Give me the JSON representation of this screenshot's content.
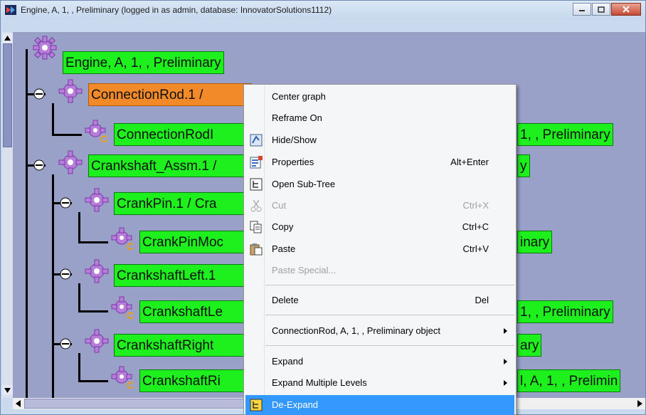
{
  "window": {
    "title": "Engine, A, 1, , Preliminary (logged in as admin, database: InnovatorSolutions1112)"
  },
  "tree": {
    "nodes": [
      {
        "label": "Engine, A, 1, , Preliminary"
      },
      {
        "label": "ConnectionRod.1 /"
      },
      {
        "label": "ConnectionRodI"
      },
      {
        "label": "1, , Preliminary"
      },
      {
        "label": "Crankshaft_Assm.1 /"
      },
      {
        "label": "y"
      },
      {
        "label": "CrankPin.1 / Cra"
      },
      {
        "label": "CrankPinMoc"
      },
      {
        "label": "inary"
      },
      {
        "label": "CrankshaftLeft.1"
      },
      {
        "label": "CrankshaftLe"
      },
      {
        "label": "1, , Preliminary"
      },
      {
        "label": "CrankshaftRight"
      },
      {
        "label": "ary"
      },
      {
        "label": "CrankshaftRi"
      },
      {
        "label": "l, A, 1, , Prelimin"
      }
    ]
  },
  "menu": {
    "items": [
      {
        "label": "Center graph",
        "shortcut": ""
      },
      {
        "label": "Reframe On",
        "shortcut": ""
      },
      {
        "label": "Hide/Show",
        "shortcut": ""
      },
      {
        "label": "Properties",
        "shortcut": "Alt+Enter"
      },
      {
        "label": "Open Sub-Tree",
        "shortcut": ""
      },
      {
        "label": "Cut",
        "shortcut": "Ctrl+X"
      },
      {
        "label": "Copy",
        "shortcut": "Ctrl+C"
      },
      {
        "label": "Paste",
        "shortcut": "Ctrl+V"
      },
      {
        "label": "Paste Special...",
        "shortcut": ""
      },
      {
        "label": "Delete",
        "shortcut": "Del"
      },
      {
        "label": "ConnectionRod, A, 1, , Preliminary object",
        "shortcut": ""
      },
      {
        "label": "Expand",
        "shortcut": ""
      },
      {
        "label": "Expand Multiple Levels",
        "shortcut": ""
      },
      {
        "label": "De-Expand",
        "shortcut": ""
      }
    ]
  },
  "colors": {
    "node_green": "#1ef01e",
    "node_selected": "#f28a2a",
    "canvas": "#9aa1c9",
    "menu_highlight": "#3399ff"
  },
  "icons": [
    "app-icon",
    "minimize-icon",
    "maximize-icon",
    "close-icon",
    "gear-icon",
    "component-gear-icon",
    "collapse-icon",
    "hide-show-icon",
    "properties-icon",
    "open-subtree-icon",
    "cut-icon",
    "copy-icon",
    "paste-icon",
    "de-expand-icon",
    "submenu-arrow-icon"
  ]
}
